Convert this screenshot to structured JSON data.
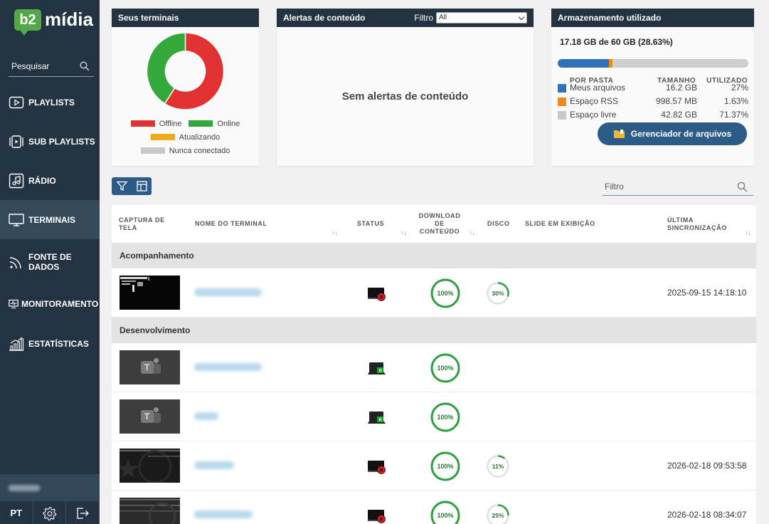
{
  "app": {
    "logo_badge": "b2",
    "logo_text": "mídia"
  },
  "sidebar": {
    "search_placeholder": "Pesquisar",
    "items": [
      {
        "label": "PLAYLISTS",
        "icon": "play-box-icon",
        "active": false
      },
      {
        "label": "SUB PLAYLISTS",
        "icon": "sub-playlist-icon",
        "active": false
      },
      {
        "label": "RÁDIO",
        "icon": "music-note-icon",
        "active": false
      },
      {
        "label": "TERMINAIS",
        "icon": "monitor-icon",
        "active": true
      },
      {
        "label_line1": "FONTE DE",
        "label_line2": "DADOS",
        "icon": "rss-icon",
        "active": false
      },
      {
        "label": "MONITORAMENTO",
        "icon": "monitoring-icon",
        "active": false
      },
      {
        "label": "ESTATÍSTICAS",
        "icon": "bar-chart-icon",
        "active": false
      }
    ],
    "language": "PT"
  },
  "terminals_card": {
    "title": "Seus terminais",
    "chart_data": {
      "type": "pie",
      "values": [
        {
          "label": "Offline",
          "fraction": 0.59,
          "color": "#e03232"
        },
        {
          "label": "Online",
          "fraction": 0.41,
          "color": "#34a83a"
        }
      ]
    },
    "legend": [
      {
        "label": "Offline",
        "color": "#e03232"
      },
      {
        "label": "Online",
        "color": "#34a83a"
      },
      {
        "label": "Atualizando",
        "color": "#f0a81d"
      },
      {
        "label": "Nunca conectado",
        "color": "#c8c8c8"
      }
    ]
  },
  "alerts_card": {
    "title": "Alertas de conteúdo",
    "filter_label": "Filtro",
    "filter_value": "All",
    "empty_text": "Sem alertas de conteúdo"
  },
  "storage_card": {
    "title": "Armazenamento utilizado",
    "total": "17.18 GB de 60 GB (28.63%)",
    "bar": [
      {
        "fraction": 0.27,
        "color": "#2f72b8"
      },
      {
        "fraction": 0.0163,
        "color": "#f08a1d"
      }
    ],
    "headers": {
      "folder": "POR PASTA",
      "size": "TAMANHO",
      "used": "UTILIZADO"
    },
    "rows": [
      {
        "name": "Meus arquivos",
        "size": "16.2 GB",
        "used": "27%",
        "color": "#2f72b8"
      },
      {
        "name": "Espaço RSS",
        "size": "998.57 MB",
        "used": "1.63%",
        "color": "#f08a1d"
      },
      {
        "name": "Espaço livre",
        "size": "42.82 GB",
        "used": "71.37%",
        "color": "#c8c8c8"
      }
    ],
    "button_label": "Gerenciador de arquivos"
  },
  "table": {
    "filter_placeholder": "Filtro",
    "headers": {
      "screenshot": "CAPTURA DE TELA",
      "name": "NOME DO TERMINAL",
      "status": "STATUS",
      "download": "DOWNLOAD DE CONTEÚDO",
      "disk": "DISCO",
      "slide": "SLIDE EM EXIBIÇÃO",
      "sync": "ÚLTIMA SINCRONIZAÇÃO"
    },
    "groups": [
      "Acompanhamento",
      "Desenvolvimento"
    ],
    "rows": [
      {
        "status": "offline",
        "download_label": "100%",
        "download": 1.0,
        "disk_label": "30%",
        "disk": 0.3,
        "sync": "2025-09-15 14:18:10"
      },
      {
        "status": "online",
        "status_count": "0",
        "download_label": "100%",
        "download": 1.0
      },
      {
        "status": "online",
        "status_count": "0",
        "download_label": "100%",
        "download": 1.0
      },
      {
        "status": "offline",
        "download_label": "100%",
        "download": 1.0,
        "disk_label": "11%",
        "disk": 0.11,
        "sync": "2026-02-18 09:53:58"
      },
      {
        "status": "offline",
        "download_label": "100%",
        "download": 1.0,
        "disk_label": "25%",
        "disk": 0.25,
        "sync": "2026-02-18 08:34:07"
      }
    ]
  }
}
